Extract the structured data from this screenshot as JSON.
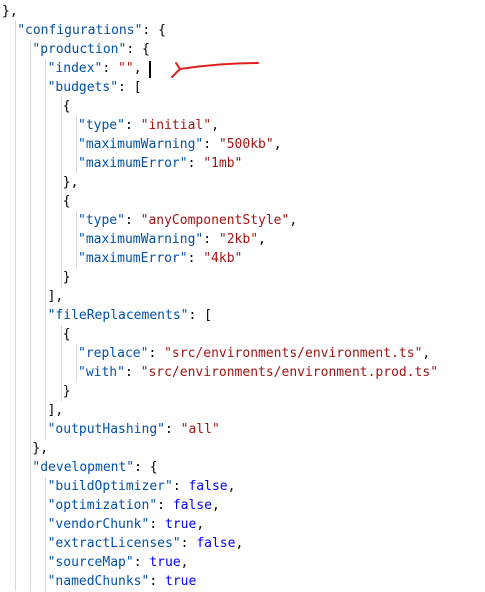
{
  "code": {
    "lines": [
      "},",
      "\"configurations\": {",
      "\"production\": {",
      "\"index\": \"\",",
      "\"budgets\": [",
      "{",
      "\"type\": \"initial\",",
      "\"maximumWarning\": \"500kb\",",
      "\"maximumError\": \"1mb\"",
      "},",
      "{",
      "\"type\": \"anyComponentStyle\",",
      "\"maximumWarning\": \"2kb\",",
      "\"maximumError\": \"4kb\"",
      "}",
      "],",
      "\"fileReplacements\": [",
      "{",
      "\"replace\": \"src/environments/environment.ts\",",
      "\"with\": \"src/environments/environment.prod.ts\"",
      "}",
      "],",
      "\"outputHashing\": \"all\"",
      "},",
      "\"development\": {",
      "\"buildOptimizer\": false,",
      "\"optimization\": false,",
      "\"vendorChunk\": true,",
      "\"extractLicenses\": false,",
      "\"sourceMap\": true,",
      "\"namedChunks\": true"
    ]
  },
  "colors": {
    "key": "#0451a5",
    "string": "#a31515",
    "boolean": "#0000ff",
    "annotation": "#e02020"
  }
}
